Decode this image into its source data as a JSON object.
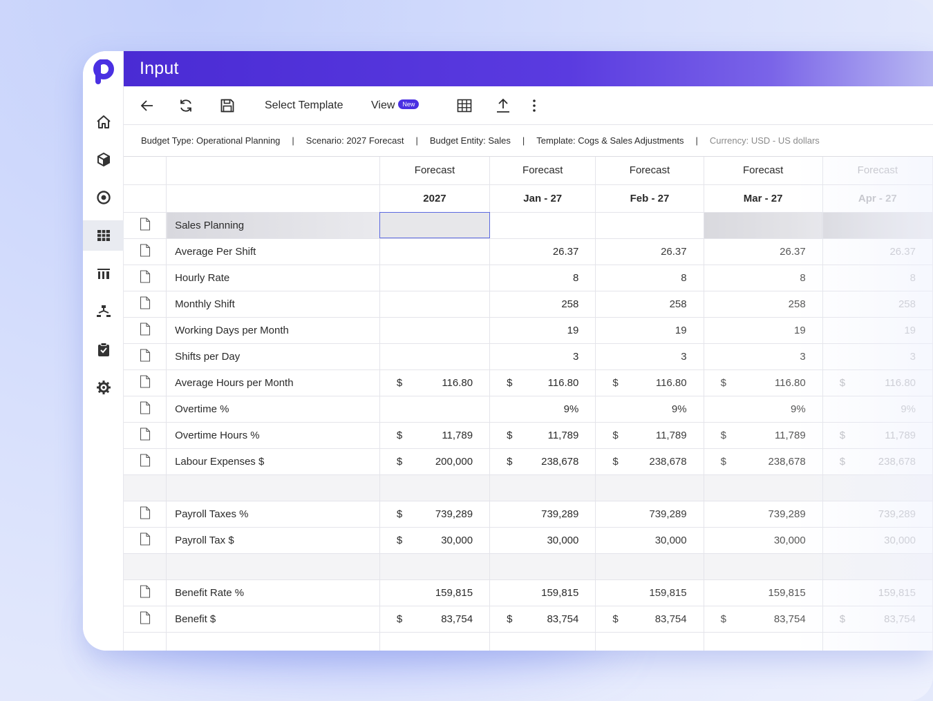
{
  "header": {
    "title": "Input"
  },
  "toolbar": {
    "select_template_label": "Select Template",
    "view_label": "View",
    "view_badge": "New"
  },
  "infobar": {
    "budget_type": "Budget Type: Operational Planning",
    "scenario": "Scenario: 2027 Forecast",
    "budget_entity": "Budget Entity: Sales",
    "template": "Template: Cogs & Sales Adjustments",
    "currency": "Currency: USD - US dollars",
    "separator": "|"
  },
  "sidebar": {
    "items": [
      {
        "icon": "home-icon"
      },
      {
        "icon": "cube-icon"
      },
      {
        "icon": "target-icon"
      },
      {
        "icon": "grid-icon",
        "active": true
      },
      {
        "icon": "building-icon"
      },
      {
        "icon": "hierarchy-icon"
      },
      {
        "icon": "clipboard-check-icon"
      },
      {
        "icon": "gear-icon"
      }
    ]
  },
  "table": {
    "columns": [
      {
        "top": "Forecast",
        "bottom": "2027"
      },
      {
        "top": "Forecast",
        "bottom": "Jan - 27"
      },
      {
        "top": "Forecast",
        "bottom": "Feb - 27"
      },
      {
        "top": "Forecast",
        "bottom": "Mar - 27"
      },
      {
        "top": "Forecast",
        "bottom": "Apr - 27"
      }
    ],
    "currency_symbol": "$",
    "rows": [
      {
        "label": "Sales Planning",
        "type": "section"
      },
      {
        "label": "Average Per Shift",
        "values": [
          "",
          "26.37",
          "26.37",
          "26.37",
          "26.37"
        ]
      },
      {
        "label": "Hourly Rate",
        "values": [
          "",
          "8",
          "8",
          "8",
          "8"
        ]
      },
      {
        "label": "Monthly Shift",
        "values": [
          "",
          "258",
          "258",
          "258",
          "258"
        ]
      },
      {
        "label": "Working Days per Month",
        "values": [
          "",
          "19",
          "19",
          "19",
          "19"
        ]
      },
      {
        "label": "Shifts per Day",
        "values": [
          "",
          "3",
          "3",
          "3",
          "3"
        ]
      },
      {
        "label": "Average Hours per Month",
        "values": [
          "116.80",
          "116.80",
          "116.80",
          "116.80",
          "116.80"
        ],
        "currency": [
          true,
          true,
          true,
          true,
          true
        ]
      },
      {
        "label": "Overtime %",
        "values": [
          "",
          "9%",
          "9%",
          "9%",
          "9%"
        ]
      },
      {
        "label": "Overtime Hours %",
        "values": [
          "11,789",
          "11,789",
          "11,789",
          "11,789",
          "11,789"
        ],
        "currency": [
          true,
          true,
          true,
          true,
          true
        ]
      },
      {
        "label": "Labour Expenses $",
        "values": [
          "200,000",
          "238,678",
          "238,678",
          "238,678",
          "238,678"
        ],
        "currency": [
          true,
          true,
          true,
          true,
          true
        ]
      },
      {
        "label": "",
        "type": "blank"
      },
      {
        "label": "Payroll Taxes %",
        "values": [
          "739,289",
          "739,289",
          "739,289",
          "739,289",
          "739,289"
        ],
        "currency": [
          true,
          false,
          false,
          false,
          false
        ]
      },
      {
        "label": "Payroll Tax $",
        "values": [
          "30,000",
          "30,000",
          "30,000",
          "30,000",
          "30,000"
        ],
        "currency": [
          true,
          false,
          false,
          false,
          false
        ]
      },
      {
        "label": "",
        "type": "blank"
      },
      {
        "label": "Benefit Rate %",
        "values": [
          "159,815",
          "159,815",
          "159,815",
          "159,815",
          "159,815"
        ]
      },
      {
        "label": "Benefit $",
        "values": [
          "83,754",
          "83,754",
          "83,754",
          "83,754",
          "83,754"
        ],
        "currency": [
          true,
          true,
          true,
          true,
          true
        ]
      }
    ]
  }
}
